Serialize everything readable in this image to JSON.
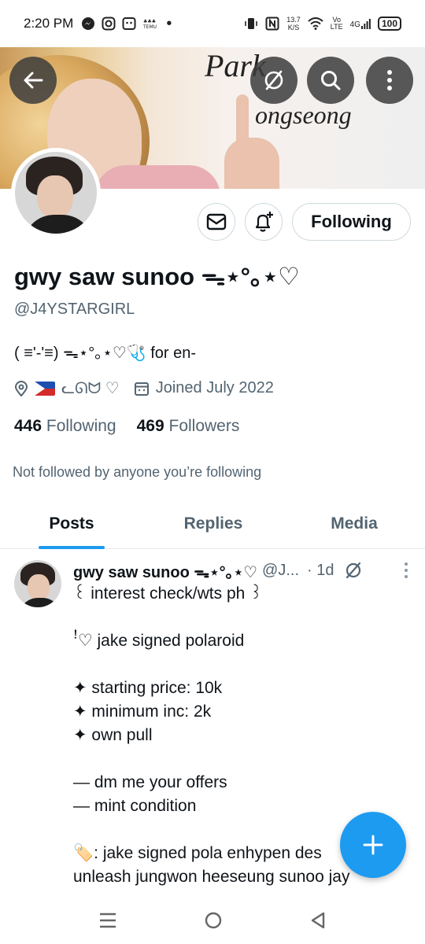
{
  "status_bar": {
    "time": "2:20 PM",
    "network_speed": "13.7\nK/S",
    "volte": "Vo\nLTE",
    "signal_gen": "4G",
    "battery": "100"
  },
  "banner": {
    "text_line1": "Park",
    "text_line2": "ongseong"
  },
  "header_actions": {
    "back_icon": "arrow-left",
    "mute_icon": "circle-slash",
    "search_icon": "magnifier",
    "more_icon": "vertical-dots"
  },
  "profile": {
    "display_name": "gwy saw sunoo ᯓ⋆°｡⋆♡",
    "handle": "@J4YSTARGIRL",
    "bio": "( ≡'-'≡) ᯓ⋆°｡⋆♡🩺  for en-",
    "location": "ᓚᘏᗢ ♡",
    "joined": "Joined July 2022",
    "following_count": "446",
    "following_label": "Following",
    "followers_count": "469",
    "followers_label": "Followers",
    "not_followed_text": "Not followed by anyone you’re following"
  },
  "actions": {
    "following_button": "Following"
  },
  "tabs": [
    {
      "label": "Posts",
      "active": true
    },
    {
      "label": "Replies",
      "active": false
    },
    {
      "label": "Media",
      "active": false
    }
  ],
  "post": {
    "name": "gwy saw sunoo ᯓ⋆°｡⋆♡",
    "handle": "@J...",
    "time": "· 1d",
    "body": "꒰ interest check/wts ph ꒱\n\nꜝ♡ jake signed polaroid\n\n✦ starting price: 10k\n✦ minimum inc: 2k\n✦ own pull\n\n— dm me your offers\n— mint condition\n\n🏷️: jake signed pola enhypen des\nunleash jungwon heeseung sunoo jay"
  },
  "colors": {
    "accent": "#1d9bf0",
    "text_primary": "#0f1419",
    "text_secondary": "#536471"
  }
}
